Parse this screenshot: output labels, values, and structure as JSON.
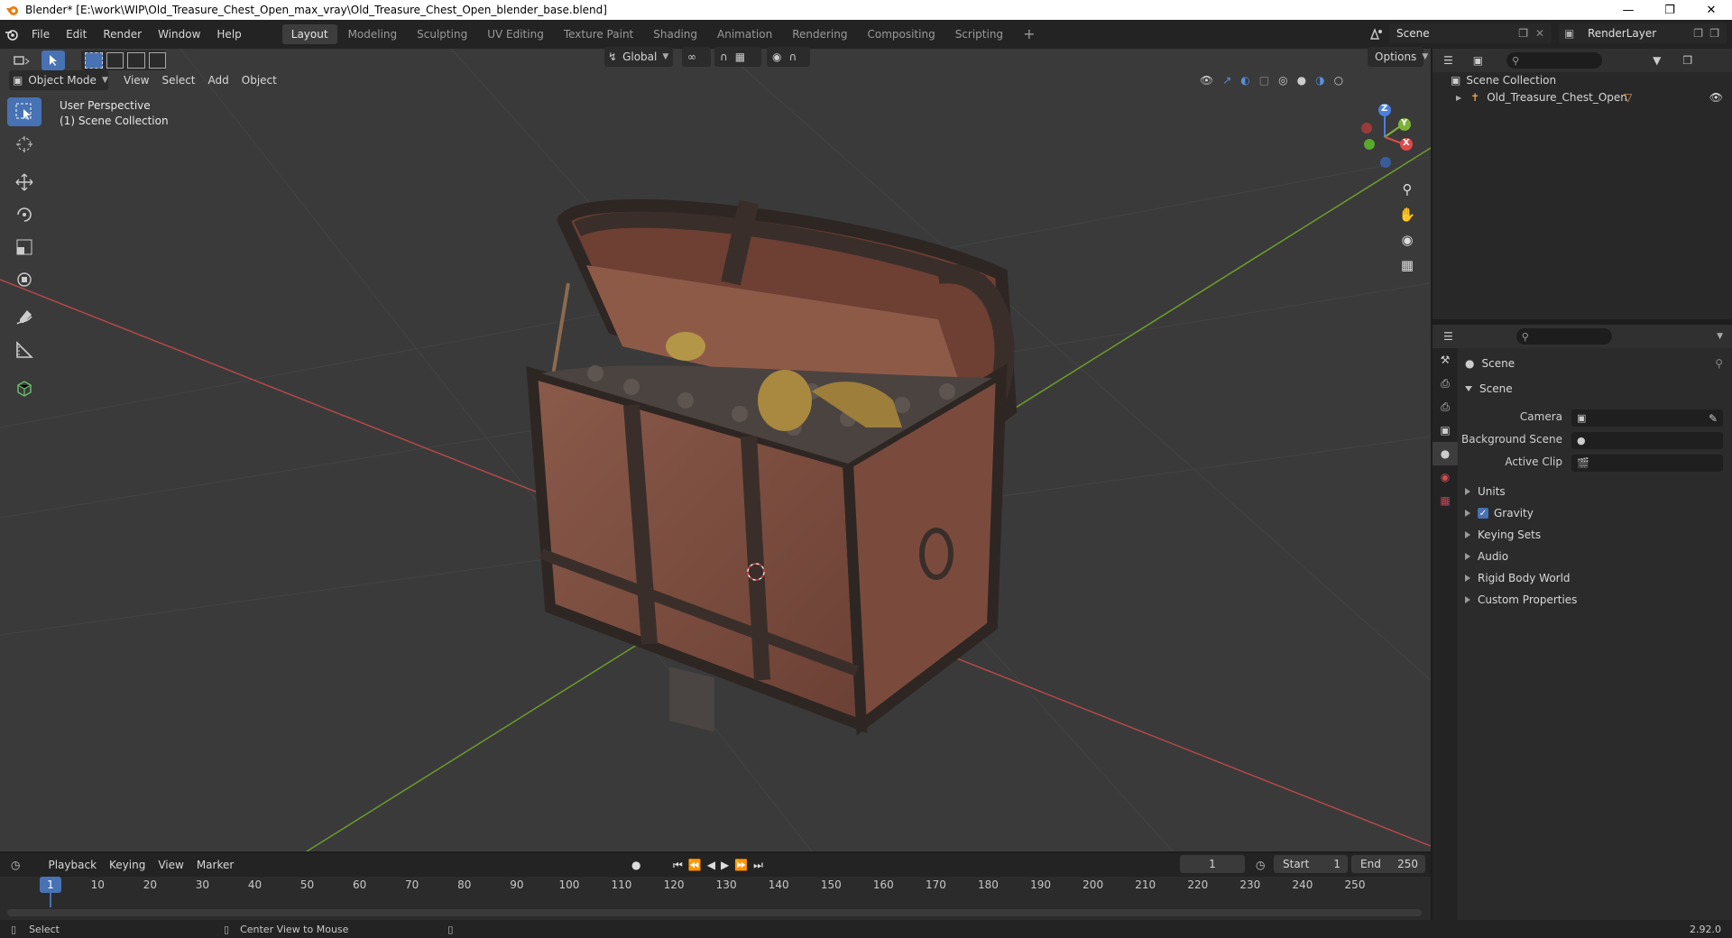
{
  "window": {
    "title": "Blender* [E:\\work\\WIP\\Old_Treasure_Chest_Open_max_vray\\Old_Treasure_Chest_Open_blender_base.blend]"
  },
  "menu": {
    "items": [
      "File",
      "Edit",
      "Render",
      "Window",
      "Help"
    ]
  },
  "workspaces": [
    "Layout",
    "Modeling",
    "Sculpting",
    "UV Editing",
    "Texture Paint",
    "Shading",
    "Animation",
    "Rendering",
    "Compositing",
    "Scripting"
  ],
  "active_workspace": "Layout",
  "scene_field": "Scene",
  "renderlayer_field": "RenderLayer",
  "viewport": {
    "orientation": "Global",
    "options_label": "Options",
    "mode": "Object Mode",
    "header_menus": [
      "View",
      "Select",
      "Add",
      "Object"
    ],
    "perspective_label": "User Perspective",
    "collection_label": "(1) Scene Collection",
    "gizmo": {
      "x": "X",
      "y": "Y",
      "z": "Z"
    }
  },
  "outliner": {
    "root": "Scene Collection",
    "object": "Old_Treasure_Chest_Open"
  },
  "properties": {
    "context": "Scene",
    "panel": "Scene",
    "camera_label": "Camera",
    "background_scene_label": "Background Scene",
    "active_clip_label": "Active Clip",
    "subpanels": [
      "Units",
      "Gravity",
      "Keying Sets",
      "Audio",
      "Rigid Body World",
      "Custom Properties"
    ],
    "gravity_checked": true
  },
  "timeline": {
    "menus": [
      "Playback",
      "Keying",
      "View",
      "Marker"
    ],
    "current_frame": "1",
    "start_label": "Start",
    "start": "1",
    "end_label": "End",
    "end": "250",
    "ticks": [
      "1",
      "10",
      "20",
      "30",
      "40",
      "50",
      "60",
      "70",
      "80",
      "90",
      "100",
      "110",
      "120",
      "130",
      "140",
      "150",
      "160",
      "170",
      "180",
      "190",
      "200",
      "210",
      "220",
      "230",
      "240",
      "250"
    ]
  },
  "statusbar": {
    "left": "Select",
    "middle": "Center View to Mouse",
    "version": "2.92.0"
  }
}
